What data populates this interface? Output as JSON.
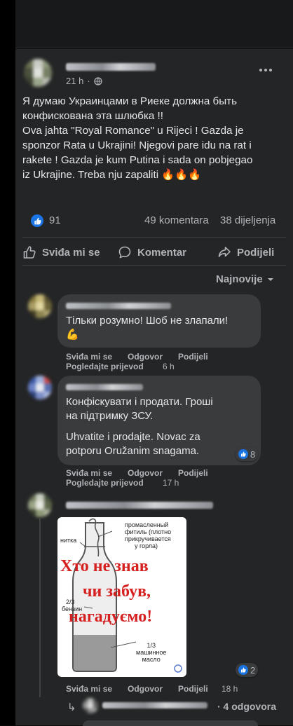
{
  "post": {
    "time": "21 h",
    "text_lines": [
      "Я думаю Украинцами в Риеке должна быть",
      "конфискована эта шлюбка !!",
      "Ova jahta \"Royal Romance\" u Rijeci ! Gazda je",
      "sponzor Rata u Ukrajini! Njegovi pare idu na rat i",
      "rakete ! Gazda je kum Putina i sada on pobjegao",
      "iz Ukrajine. Treba nju zapaliti 🔥🔥🔥"
    ],
    "reaction_count": "91",
    "comments_count": "49 komentara",
    "shares_count": "38 dijeljenja"
  },
  "actions": {
    "like": "Sviđa mi se",
    "comment": "Komentar",
    "share": "Podijeli"
  },
  "sort_label": "Najnovije",
  "comments": [
    {
      "text": "Тільки розумно! Шоб не злапали!",
      "emoji": "💪",
      "like": "Sviđa mi se",
      "reply": "Odgovor",
      "share": "Podijeli",
      "translate": "Pogledajte prijevod",
      "time": "6 h"
    },
    {
      "text_lines": [
        "Конфіскувати і продати. Гроші",
        "на підтримку ЗСУ."
      ],
      "translation_lines": [
        "Uhvatite i prodajte. Novac za",
        "potporu Oružanim snagama."
      ],
      "reactions": "8",
      "like": "Sviđa mi se",
      "reply": "Odgovor",
      "share": "Podijeli",
      "translate": "Pogledajte prijevod",
      "time": "17 h"
    },
    {
      "image": {
        "label_wick": "промасленный",
        "label_wick2": "фитиль (плотно",
        "label_wick3": "прикручивается",
        "label_wick4": "у горла)",
        "label_thread": "нитка",
        "label_gas1": "2/3",
        "label_gas2": "бензин",
        "label_oil1": "1/3",
        "label_oil2": "машинное",
        "label_oil3": "масло",
        "big1": "Хто не знав",
        "big2": "чи забув,",
        "big3": "нагадуємо!"
      },
      "reactions": "2",
      "like": "Sviđa mi se",
      "reply": "Odgovor",
      "share": "Podijeli",
      "time": "18 h",
      "replies_label": "· 4 odgovora"
    }
  ],
  "colors": {
    "bg": "#242526",
    "bubble": "#3a3b3c",
    "accent": "#1b74e4",
    "fire_red": "#d61f1f"
  }
}
